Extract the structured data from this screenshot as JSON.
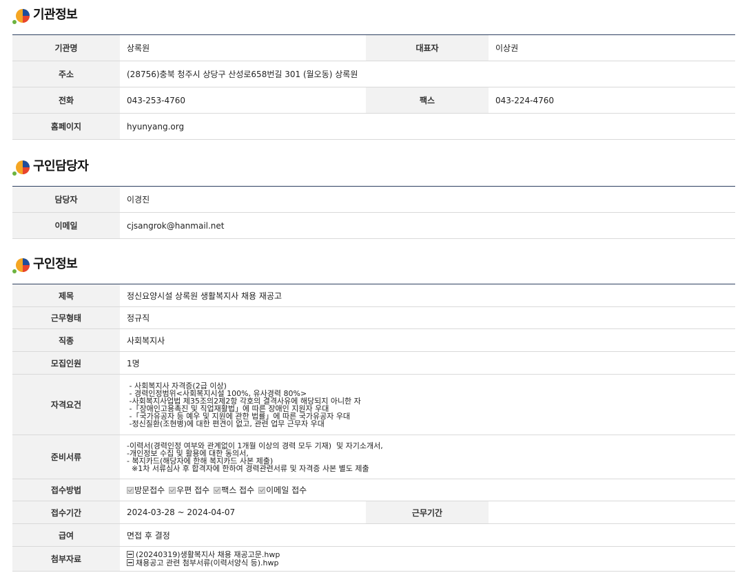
{
  "org": {
    "title": "기관정보",
    "name_label": "기관명",
    "name": "상록원",
    "rep_label": "대표자",
    "rep": "이상권",
    "addr_label": "주소",
    "addr": "(28756)충북 청주시 상당구 산성로658번길 301 (월오동) 상록원",
    "tel_label": "전화",
    "tel": "043-253-4760",
    "fax_label": "팩스",
    "fax": "043-224-4760",
    "home_label": "홈페이지",
    "home": "hyunyang.org"
  },
  "contact": {
    "title": "구인담당자",
    "person_label": "담당자",
    "person": "이경진",
    "email_label": "이메일",
    "email": "cjsangrok@hanmail.net"
  },
  "job": {
    "title": "구인정보",
    "subject_label": "제목",
    "subject": "정신요양시설 상록원 생활복지사 채용 재공고",
    "type_label": "근무형태",
    "type": "정규직",
    "category_label": "직종",
    "category": "사회복지사",
    "count_label": "모집인원",
    "count": "1명",
    "qual_label": "자격요건",
    "qual_lines": [
      " - 사회복지사 자격증(2급 이상)",
      " - 경력인정범위<사회복지시설 100%, 유사경력 80%>",
      " -사회복지사업법 제35조의2제2항 각호의 결격사유에 해당되지 아니한 자",
      " -「장애인고용촉진 및 직업재활법」에 따른 장애인 지원자 우대",
      " -「국가유공자 등 예우 및 지원에 관한 법률」에 따른 국가유공자 우대",
      " -정신질환(조현병)에 대한 편견이 없고, 관련 업무 근무자 우대"
    ],
    "docs_label": "준비서류",
    "docs_lines": [
      "-이력서(경력인정 여부와 관계없이 1개월 이상의 경력 모두 기재)  및 자기소개서,",
      "-개인정보 수집 및 활용에 대한 동의서,",
      "- 복지카드(해당자에 한해 복지카드 사본 제출)",
      "  ※1차 서류심사 후 합격자에 한하여 경력관련서류 및 자격증 사본 별도 제출"
    ],
    "method_label": "접수방법",
    "methods": [
      "방문접수",
      "우편 접수",
      "팩스 접수",
      "이메일 접수"
    ],
    "period_label": "접수기간",
    "period": "2024-03-28 ~ 2024-04-07",
    "work_period_label": "근무기간",
    "work_period": "",
    "salary_label": "급여",
    "salary": "면접 후 결정",
    "attach_label": "첨부자료",
    "attachments": [
      "(20240319)생활복지사 채용 재공고문.hwp",
      "채용공고 관련 첨부서류(이력서양식 등).hwp"
    ]
  },
  "colors": {
    "header_line": "#2c3e5f",
    "th_bg": "#f2f2f2",
    "border": "#d9d9d9"
  }
}
